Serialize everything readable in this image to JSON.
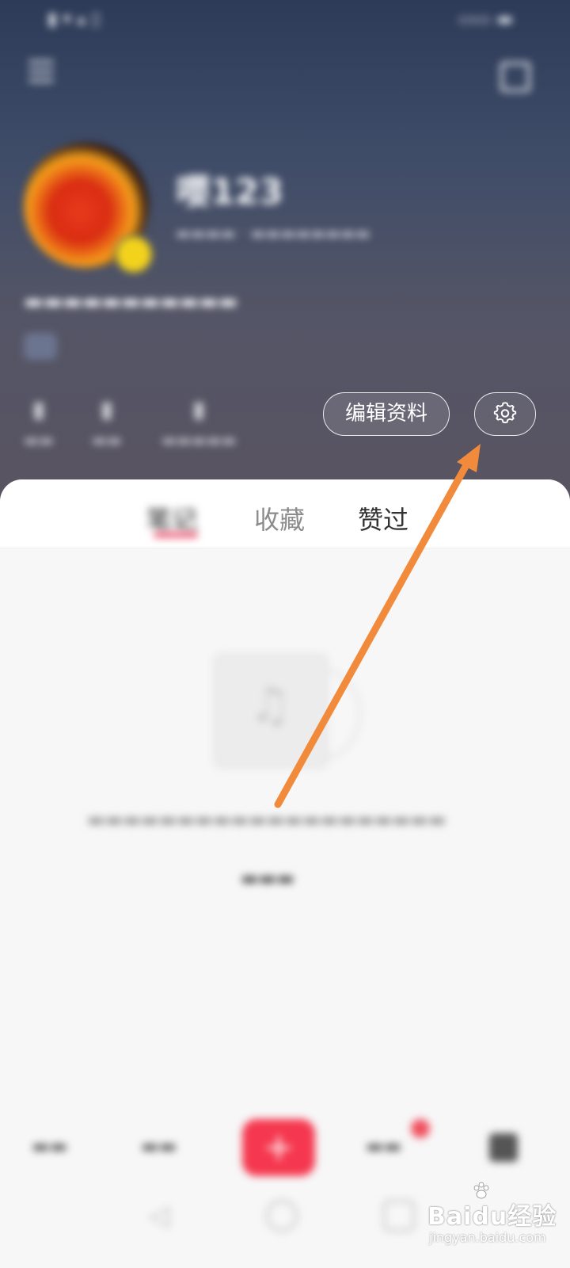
{
  "header": {
    "nickname": "嘤123",
    "edit_profile_label": "编辑资料",
    "settings_icon": "gear-icon",
    "menu_icon": "menu-icon",
    "share_icon": "share-icon"
  },
  "tabs": [
    "笔记",
    "收藏",
    "赞过"
  ],
  "empty_state": {
    "icon": "music-note-icon"
  },
  "bottom_nav": {
    "plus_label": "+"
  },
  "annotation": {
    "arrow_color": "#f28a3c"
  },
  "watermark": {
    "brand": "Baidu经验",
    "url": "jingyan.baidu.com"
  },
  "colors": {
    "accent": "#ef4061",
    "publish_button": "#f5384f"
  }
}
